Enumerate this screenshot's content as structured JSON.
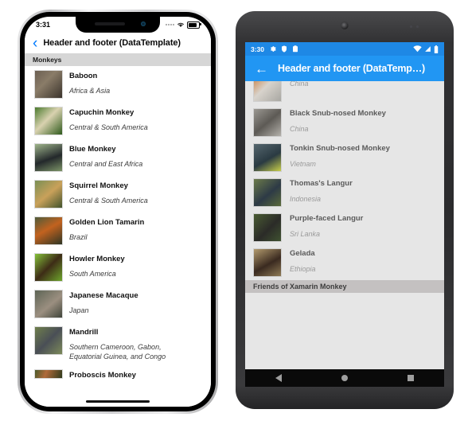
{
  "ios": {
    "status": {
      "time": "3:31",
      "wifi_icon": "wifi-icon",
      "battery_icon": "battery-icon",
      "signal_icon": "signal-dots-icon"
    },
    "nav": {
      "back_icon": "chevron-left-icon",
      "title": "Header and footer (DataTemplate)"
    },
    "section_header": "Monkeys",
    "rows": [
      {
        "name": "Baboon",
        "location": "Africa & Asia",
        "c1": "#6b5f52",
        "c2": "#3a332c"
      },
      {
        "name": "Capuchin Monkey",
        "location": "Central & South America",
        "c1": "#4b7a2e",
        "c2": "#d9d2b0"
      },
      {
        "name": "Blue Monkey",
        "location": "Central and East Africa",
        "c1": "#8fa87b",
        "c2": "#23282b"
      },
      {
        "name": "Squirrel Monkey",
        "location": "Central & South America",
        "c1": "#7a8f55",
        "c2": "#c9a15a"
      },
      {
        "name": "Golden Lion Tamarin",
        "location": "Brazil",
        "c1": "#4f5b3a",
        "c2": "#c2621f"
      },
      {
        "name": "Howler Monkey",
        "location": "South America",
        "c1": "#86c23a",
        "c2": "#3d2c16"
      },
      {
        "name": "Japanese Macaque",
        "location": "Japan",
        "c1": "#5d6455",
        "c2": "#9b8f80"
      },
      {
        "name": "Mandrill",
        "location": "Southern Cameroon, Gabon, Equatorial Guinea, and Congo",
        "c1": "#6f7f4c",
        "c2": "#4a4f56"
      },
      {
        "name": "Proboscis Monkey",
        "location": "",
        "c1": "#4a5a2a",
        "c2": "#b06a3a"
      }
    ],
    "home_indicator": "home-indicator"
  },
  "android": {
    "status": {
      "time": "3:30",
      "left_icons": [
        "gear-icon",
        "shield-icon",
        "clipboard-icon"
      ],
      "right_icons": [
        "wifi-icon",
        "signal-icon",
        "battery-icon"
      ]
    },
    "nav": {
      "back_icon": "arrow-left-icon",
      "title": "Header and footer (DataTemp…)"
    },
    "rows": [
      {
        "name": "",
        "location": "China",
        "c1": "#a8a7a2",
        "c2": "#c97b3a"
      },
      {
        "name": "Black Snub-nosed Monkey",
        "location": "China",
        "c1": "#8a8782",
        "c2": "#5d5a55"
      },
      {
        "name": "Tonkin Snub-nosed Monkey",
        "location": "Vietnam",
        "c1": "#3f4f55",
        "c2": "#c8cf4a"
      },
      {
        "name": "Thomas's Langur",
        "location": "Indonesia",
        "c1": "#5c6b3a",
        "c2": "#2d3a46"
      },
      {
        "name": "Purple-faced Langur",
        "location": "Sri Lanka",
        "c1": "#4a5c33",
        "c2": "#2b2b28"
      },
      {
        "name": "Gelada",
        "location": "Ethiopia",
        "c1": "#8e7a55",
        "c2": "#3a2a20"
      }
    ],
    "footer": "Friends of Xamarin Monkey",
    "navbar": {
      "back_icon": "nav-back-triangle-icon",
      "home_icon": "nav-home-circle-icon",
      "recents_icon": "nav-recents-square-icon"
    }
  }
}
